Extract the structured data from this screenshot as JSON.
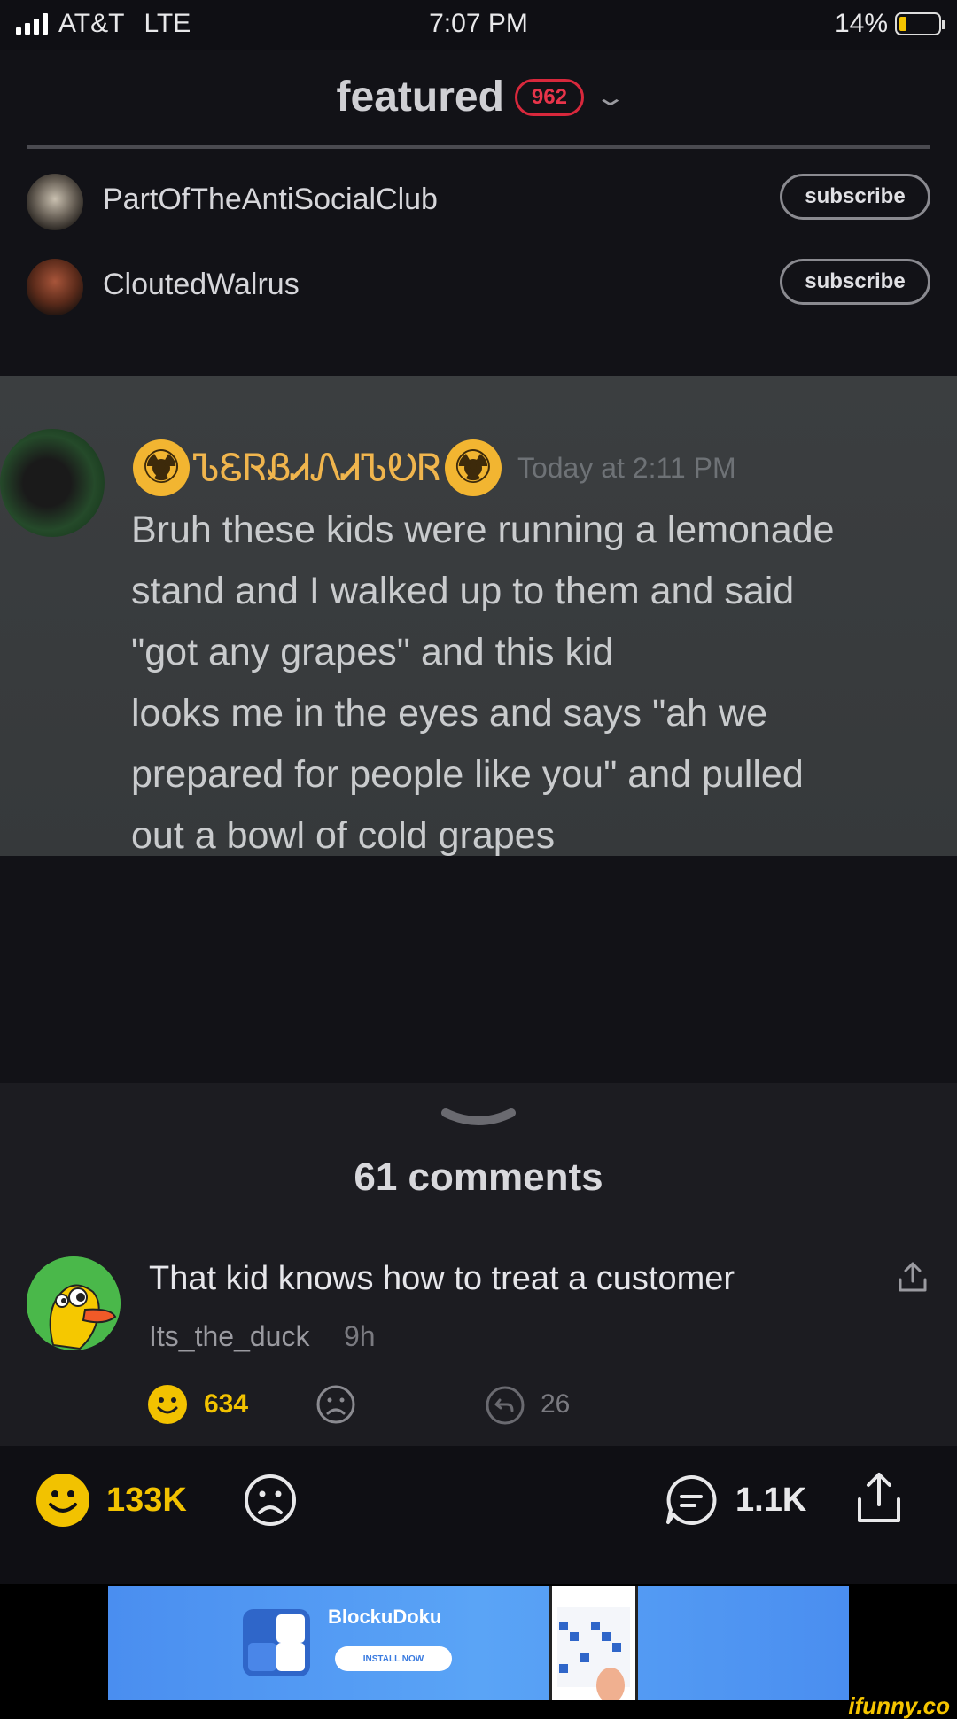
{
  "status": {
    "carrier": "AT&T",
    "network": "LTE",
    "time": "7:07 PM",
    "battery": "14%",
    "battery_level": 0.14
  },
  "header": {
    "title": "featured",
    "badge": "962",
    "chevron_icon": "chevron-down-icon"
  },
  "users": [
    {
      "name": "PartOfTheAntiSocialClub",
      "button": "subscribe"
    },
    {
      "name": "CloutedWalrus",
      "button": "subscribe"
    }
  ],
  "post": {
    "author": "ᏆᏋᏒᎷᏆᏁᎪᏆᏫᏒ",
    "author_display": "ᏖᏋᏒᏰᏗᏁᏗᏖᎧᏒ",
    "time": "Today at 2:11 PM",
    "lines": [
      "Bruh these kids were running a lemonade",
      "stand and I walked up to them and said",
      "\"got any grapes\" and this kid",
      "looks me in the eyes and says \"ah we",
      "prepared for people like you\" and pulled",
      "out a bowl of cold grapes"
    ]
  },
  "comments": {
    "title": "61 comments",
    "items": [
      {
        "text": "That kid knows how to treat a customer",
        "user": "Its_the_duck",
        "age": "9h",
        "smiles": "634",
        "replies": "26"
      }
    ]
  },
  "bottombar": {
    "smiles": "133K",
    "comments": "1.1K"
  },
  "ad": {
    "name": "BlockuDoku",
    "install": "INSTALL NOW"
  },
  "footer": {
    "watermark": "ifunny.co"
  },
  "colors": {
    "accent_yellow": "#f2c200",
    "badge_red": "#d8283c",
    "background": "#121217"
  }
}
